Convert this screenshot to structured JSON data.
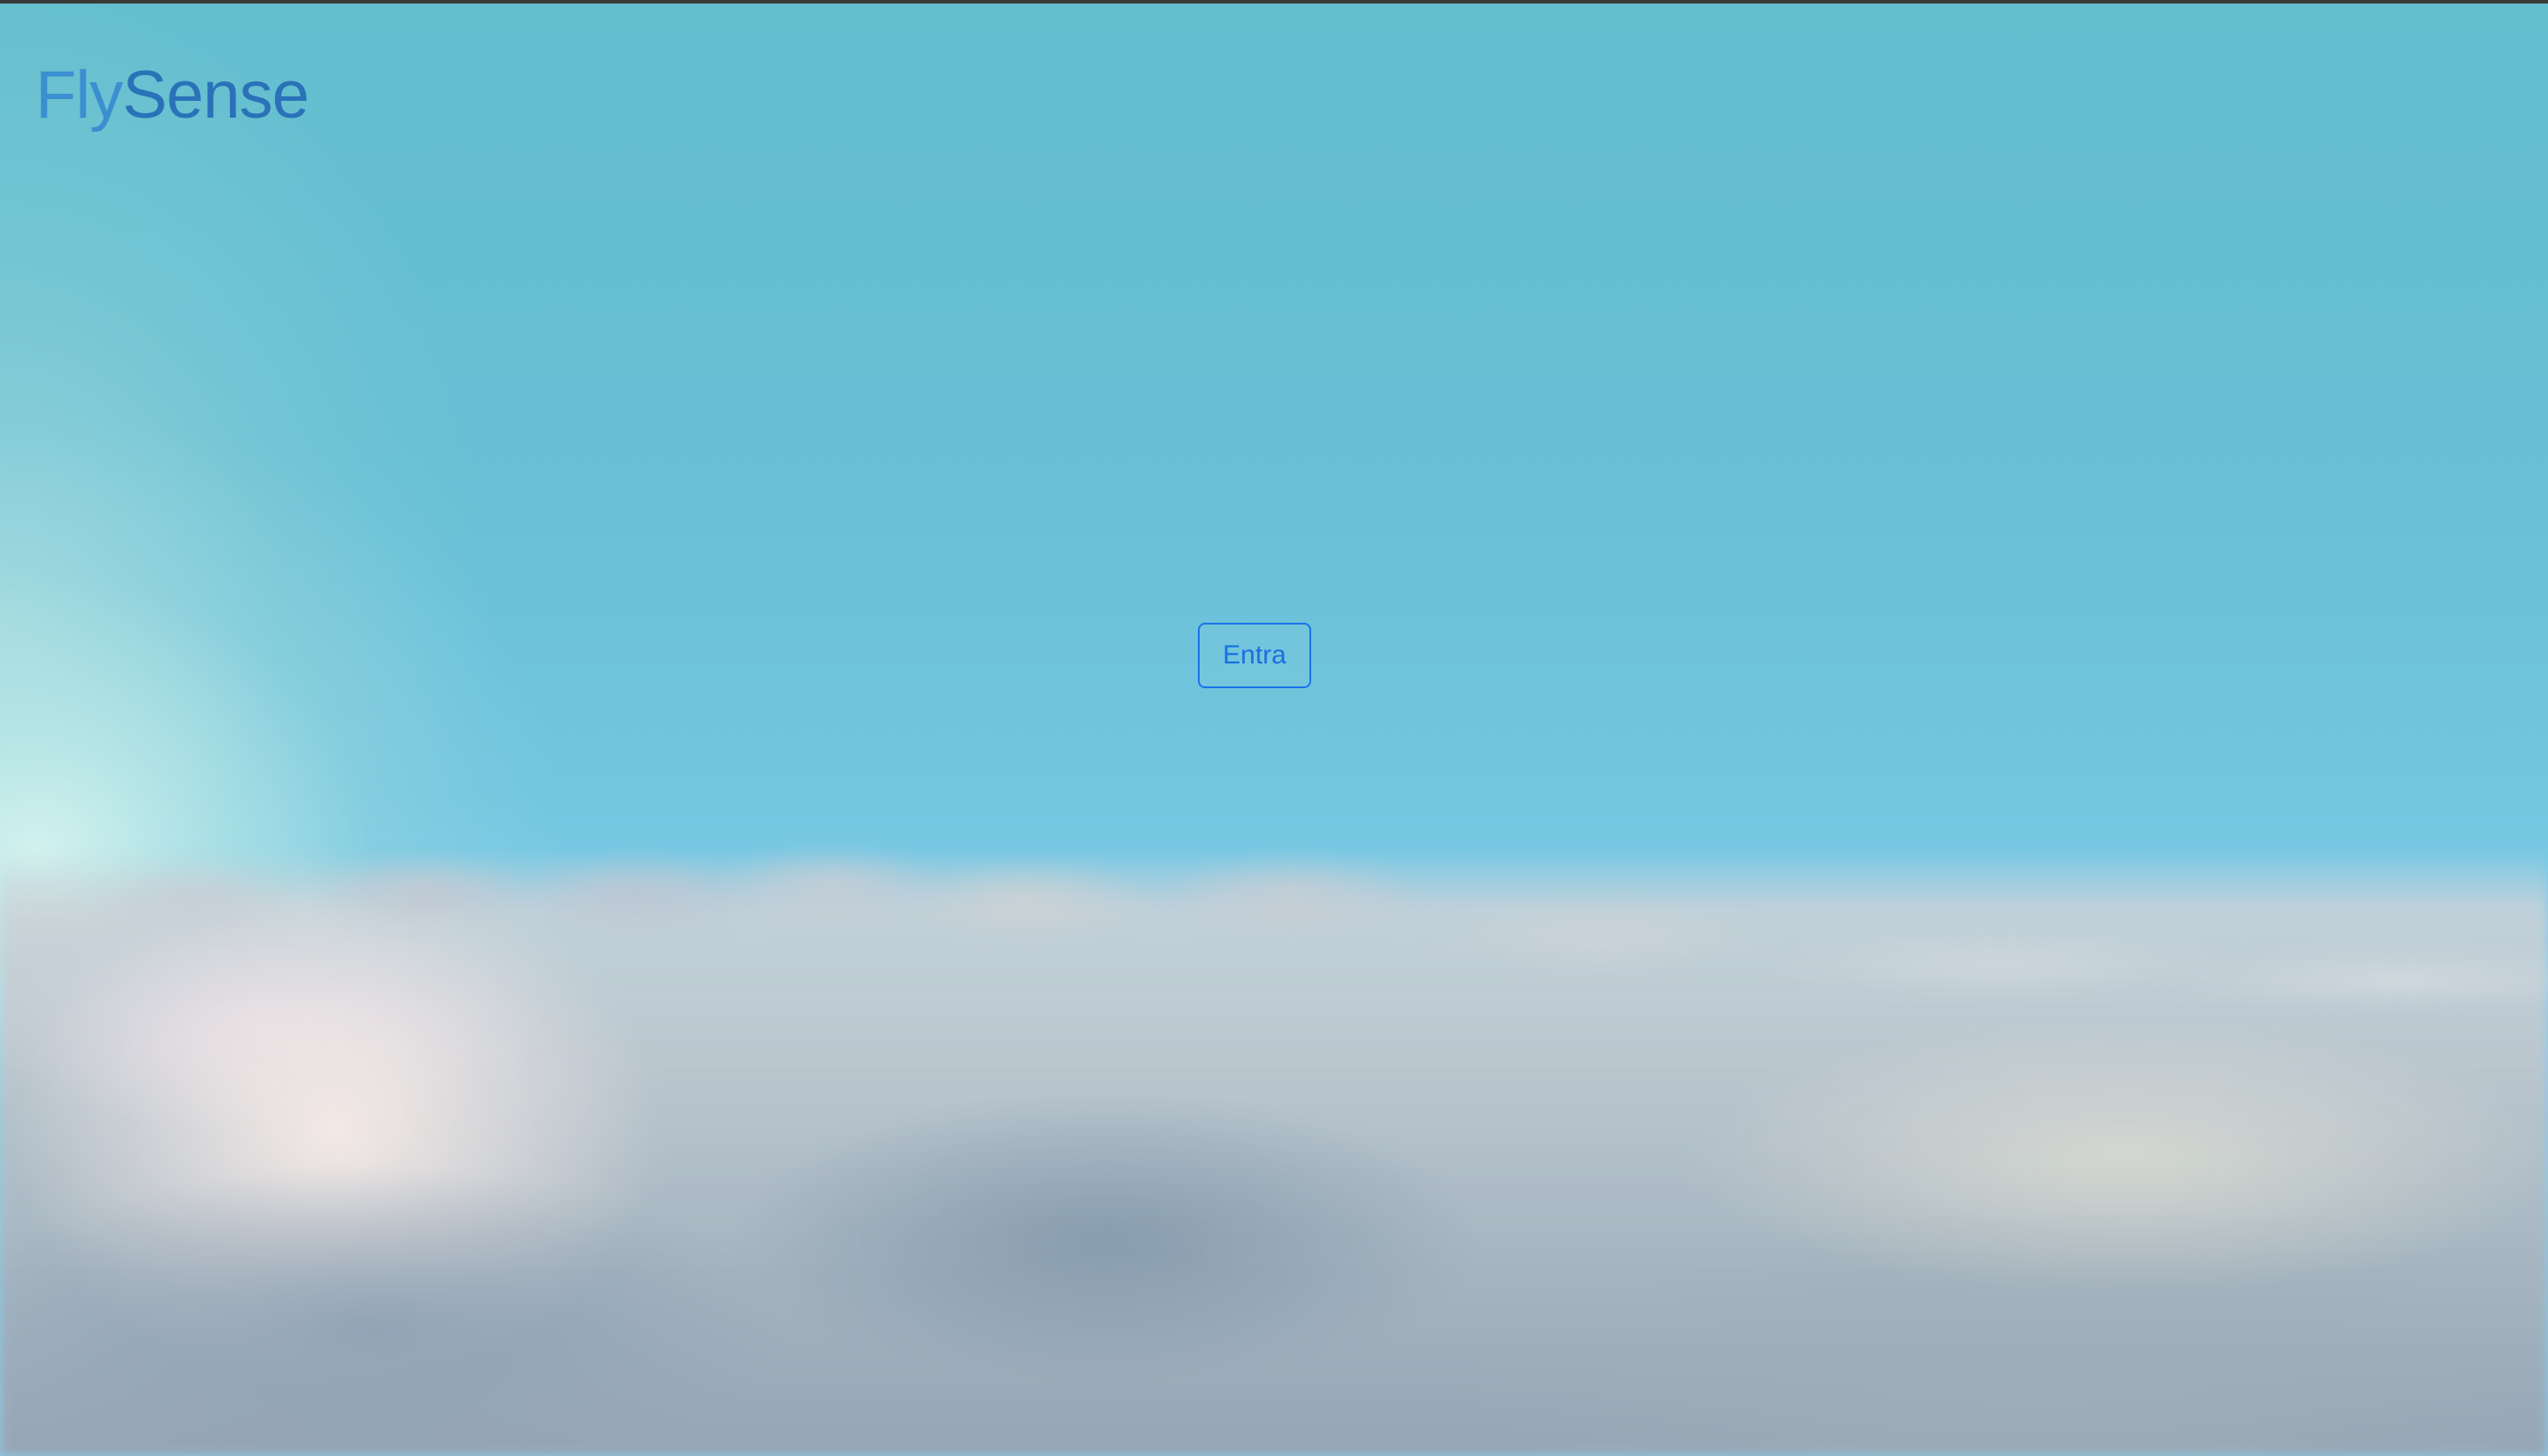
{
  "brand": {
    "part1": "Fly",
    "part2": "Sense",
    "colors": {
      "fly": "#3a8fd0",
      "sense": "#2a72b8"
    }
  },
  "main": {
    "enter_label": "Entra",
    "accent": "#1a73e8"
  },
  "background": {
    "scene": "sky-with-clouds",
    "sky_color": "#6cc3d8"
  }
}
